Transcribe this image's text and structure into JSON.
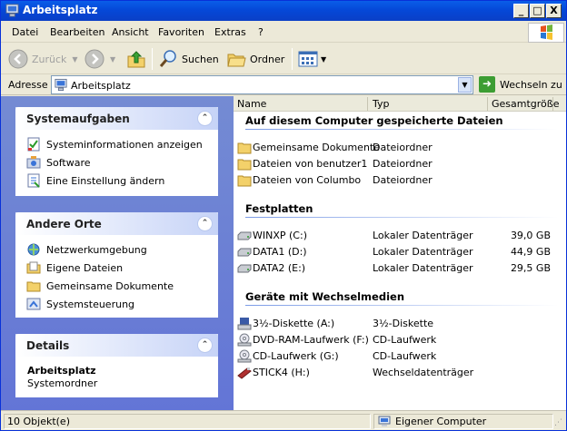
{
  "window": {
    "title": "Arbeitsplatz",
    "min": "_",
    "max": "□",
    "close": "X"
  },
  "menu": {
    "items": [
      "Datei",
      "Bearbeiten",
      "Ansicht",
      "Favoriten",
      "Extras",
      "?"
    ]
  },
  "toolbar": {
    "back": "Zurück",
    "search": "Suchen",
    "folders": "Ordner"
  },
  "address": {
    "label": "Adresse",
    "value": "Arbeitsplatz",
    "go": "Wechseln zu"
  },
  "left": {
    "system": {
      "title": "Systemaufgaben",
      "items": [
        "Systeminformationen anzeigen",
        "Software",
        "Eine Einstellung ändern"
      ]
    },
    "places": {
      "title": "Andere Orte",
      "items": [
        "Netzwerkumgebung",
        "Eigene Dateien",
        "Gemeinsame Dokumente",
        "Systemsteuerung"
      ]
    },
    "details": {
      "title": "Details",
      "name": "Arbeitsplatz",
      "type": "Systemordner"
    }
  },
  "columns": {
    "name": "Name",
    "type": "Typ",
    "size": "Gesamtgröße"
  },
  "groups": {
    "stored": {
      "title": "Auf diesem Computer gespeicherte Dateien",
      "items": [
        {
          "name": "Gemeinsame Dokumente",
          "type": "Dateiordner",
          "size": ""
        },
        {
          "name": "Dateien von benutzer1",
          "type": "Dateiordner",
          "size": ""
        },
        {
          "name": "Dateien von Columbo",
          "type": "Dateiordner",
          "size": ""
        }
      ]
    },
    "disks": {
      "title": "Festplatten",
      "items": [
        {
          "name": "WINXP (C:)",
          "type": "Lokaler Datenträger",
          "size": "39,0 GB"
        },
        {
          "name": "DATA1 (D:)",
          "type": "Lokaler Datenträger",
          "size": "44,9 GB"
        },
        {
          "name": "DATA2 (E:)",
          "type": "Lokaler Datenträger",
          "size": "29,5 GB"
        }
      ]
    },
    "removable": {
      "title": "Geräte mit Wechselmedien",
      "items": [
        {
          "name": "3½-Diskette (A:)",
          "type": "3½-Diskette",
          "size": ""
        },
        {
          "name": "DVD-RAM-Laufwerk (F:)",
          "type": "CD-Laufwerk",
          "size": ""
        },
        {
          "name": "CD-Laufwerk (G:)",
          "type": "CD-Laufwerk",
          "size": ""
        },
        {
          "name": "STICK4 (H:)",
          "type": "Wechseldatenträger",
          "size": ""
        }
      ]
    }
  },
  "status": {
    "count": "10 Objekt(e)",
    "zone": "Eigener Computer"
  },
  "colors": {
    "titlebar": "#0548d8",
    "leftpane": "#6375d6",
    "panelhead_text": "#222222",
    "group_line": "#7b9be6"
  }
}
